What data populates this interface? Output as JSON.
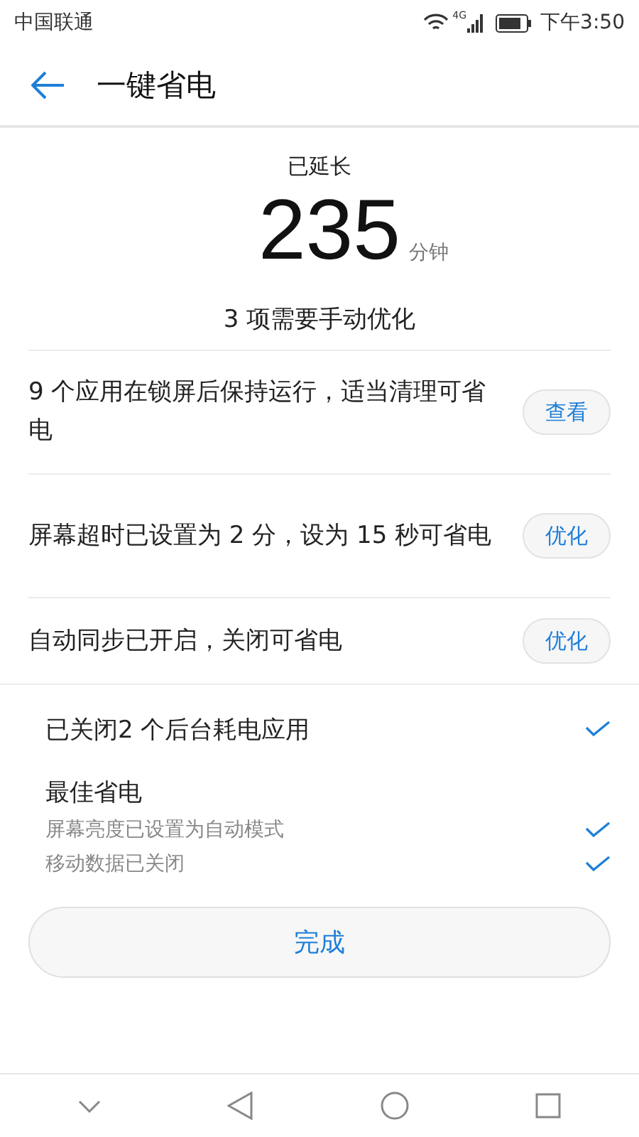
{
  "status_bar": {
    "carrier": "中国联通",
    "network": "4G",
    "time": "下午3:50"
  },
  "header": {
    "title": "一键省电"
  },
  "summary": {
    "label": "已延长",
    "value": "235",
    "unit": "分钟"
  },
  "manual": {
    "title": "3 项需要手动优化",
    "items": [
      {
        "text": "9 个应用在锁屏后保持运行，适当清理可省电",
        "action": "查看"
      },
      {
        "text": "屏幕超时已设置为 2 分，设为 15 秒可省电",
        "action": "优化"
      },
      {
        "text": "自动同步已开启，关闭可省电",
        "action": "优化"
      }
    ]
  },
  "done": [
    {
      "kind": "item",
      "text": "已关闭2 个后台耗电应用",
      "checked": true
    },
    {
      "kind": "heading",
      "text": "最佳省电"
    },
    {
      "kind": "sub",
      "text": "屏幕亮度已设置为自动模式",
      "checked": true
    },
    {
      "kind": "sub",
      "text": "移动数据已关闭",
      "checked": true
    }
  ],
  "finish_button": "完成"
}
